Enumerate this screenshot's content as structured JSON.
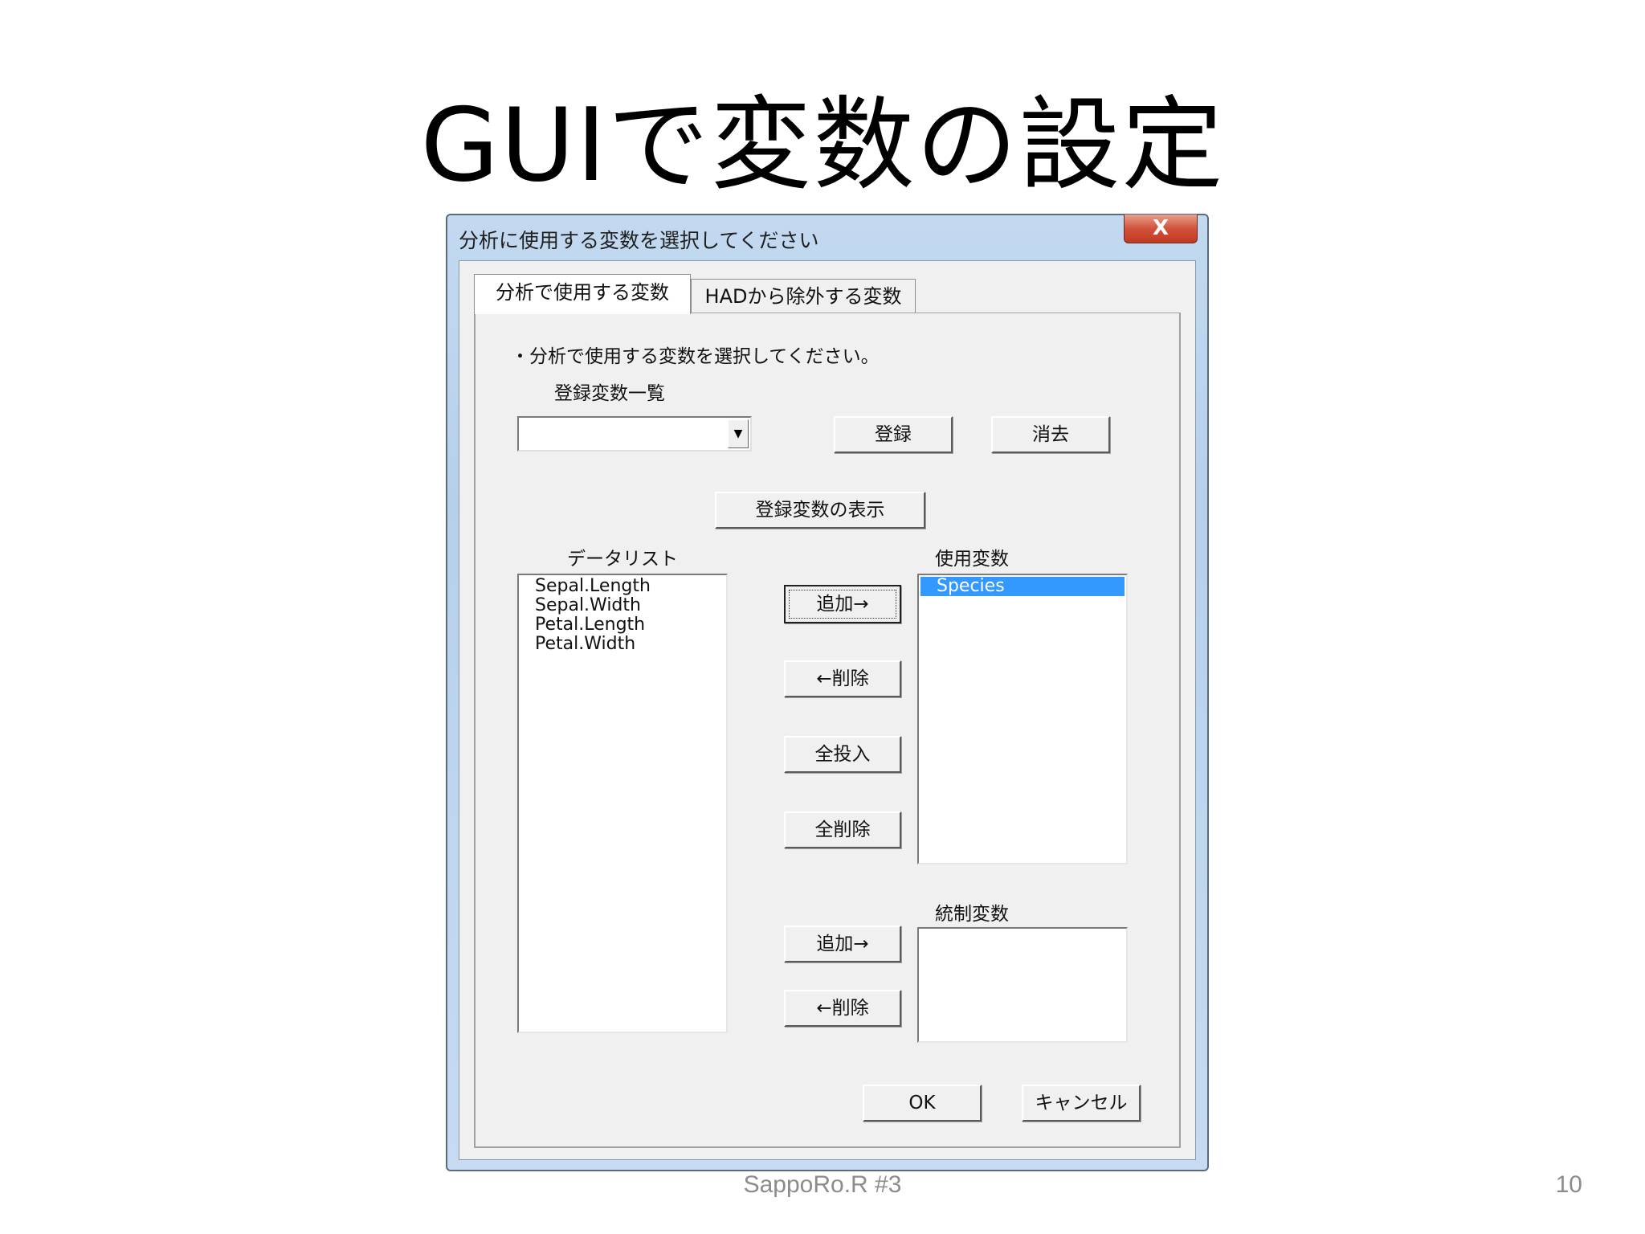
{
  "slide": {
    "title": "GUIで変数の設定",
    "footer": "SappoRo.R #3",
    "page_number": "10"
  },
  "dialog": {
    "title": "分析に使用する変数を選択してください",
    "close_label": "X",
    "tabs": [
      {
        "label": "分析で使用する変数",
        "active": true
      },
      {
        "label": "HADから除外する変数",
        "active": false
      }
    ],
    "instruction": "・分析で使用する変数を選択してください。",
    "registered_label": "登録変数一覧",
    "registered_combo_value": "",
    "register_button": "登録",
    "erase_button": "消去",
    "show_registered_button": "登録変数の表示",
    "data_list_label": "データリスト",
    "data_list": [
      "Sepal.Length",
      "Sepal.Width",
      "Petal.Length",
      "Petal.Width"
    ],
    "used_vars_label": "使用変数",
    "used_vars": [
      "Species"
    ],
    "used_selected_index": 0,
    "add_button": "追加→",
    "remove_button": "←削除",
    "add_all_button": "全投入",
    "remove_all_button": "全削除",
    "control_vars_label": "統制変数",
    "control_vars": [],
    "control_add_button": "追加→",
    "control_remove_button": "←削除",
    "ok_button": "OK",
    "cancel_button": "キャンセル"
  },
  "colors": {
    "selection": "#3399ff",
    "dialog_face": "#f0f0f0",
    "title_bar": "#bdd5ee",
    "close_button": "#c8452c"
  }
}
